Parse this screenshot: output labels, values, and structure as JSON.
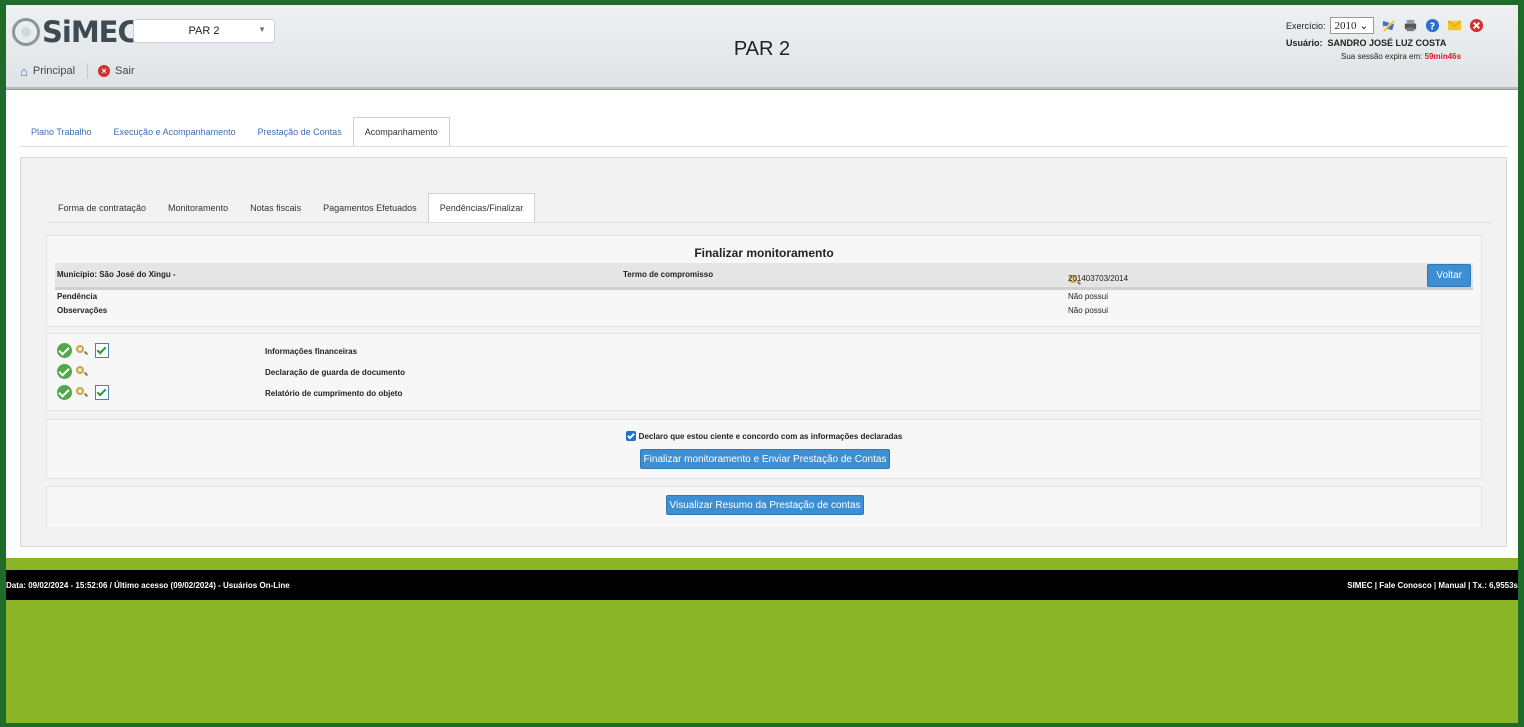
{
  "app": {
    "logo": "SiMEC",
    "system_selected": "PAR 2",
    "page_title": "PAR 2"
  },
  "nav": {
    "home": "Principal",
    "exit": "Sair"
  },
  "header_right": {
    "exercicio_label": "Exercício:",
    "exercicio_value": "2010",
    "user_label": "Usuário:",
    "user_name": "SANDRO JOSÉ LUZ COSTA",
    "session_text": "Sua sessão expira em:",
    "session_time": "59min46s"
  },
  "tabs_main": [
    "Plano Trabalho",
    "Execução e Acompanhamento",
    "Prestação de Contas",
    "Acompanhamento"
  ],
  "tabs_sub": [
    "Forma de contratação",
    "Monitoramento",
    "Notas fiscais",
    "Pagamentos Efetuados",
    "Pendências/Finalizar"
  ],
  "finalizar": {
    "title": "Finalizar monitoramento",
    "municipio": "Município: São José do Xingu -",
    "termo_label": "Termo de compromisso",
    "termo_value": "201403703/2014",
    "voltar": "Voltar",
    "pendencia_label": "Pendência",
    "pendencia_value": "Não possui",
    "observacoes_label": "Observações",
    "observacoes_value": "Não possui"
  },
  "documents": [
    {
      "label": "Informações financeiras"
    },
    {
      "label": "Declaração de guarda de documento"
    },
    {
      "label": "Relatório de cumprimento do objeto"
    }
  ],
  "declaration": {
    "text": "Declaro que estou ciente e concordo com as informações declaradas",
    "button": "Finalizar monitoramento e Enviar Prestação de Contas"
  },
  "resumo_button": "Visualizar Resumo da Prestação de contas",
  "footer": {
    "left": "Data: 09/02/2024 - 15:52:06 / Último acesso (09/02/2024) - Usuários On-Line",
    "right": "SIMEC |   Fale Conosco   |   Manual   |   Tx.: 6,9553s"
  },
  "colors": {
    "accent": "#3d8fd1",
    "background": "#8ab526",
    "session_time": "#e5172c"
  }
}
